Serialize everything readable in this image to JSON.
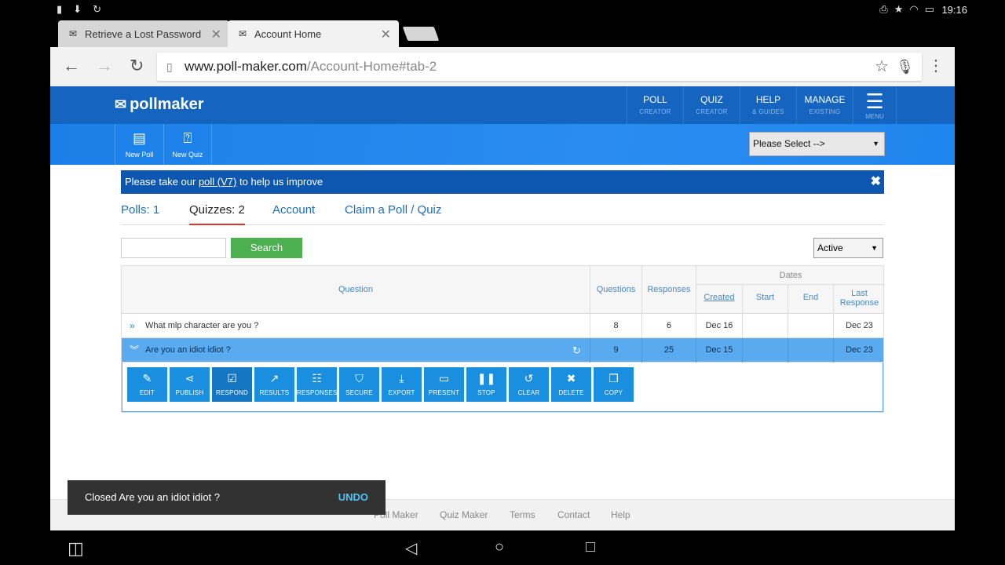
{
  "status_bar": {
    "time": "19:16"
  },
  "browser": {
    "tabs": [
      {
        "title": "Retrieve a Lost Password",
        "close": "✕"
      },
      {
        "title": "Account Home",
        "close": "✕"
      }
    ],
    "url_host": "www.poll-maker.com",
    "url_path": "/Account-Home#tab-2"
  },
  "site": {
    "logo_text": "pollmaker",
    "nav": [
      {
        "label": "POLL",
        "sub": "CREATOR"
      },
      {
        "label": "QUIZ",
        "sub": "CREATOR"
      },
      {
        "label": "HELP",
        "sub": "& GUIDES"
      },
      {
        "label": "MANAGE",
        "sub": "EXISTING"
      }
    ],
    "menu_label": "MENU",
    "subnav": [
      {
        "label": "New Poll"
      },
      {
        "label": "New Quiz"
      }
    ],
    "please_select": "Please Select -->"
  },
  "banner": {
    "prefix": "Please take our ",
    "link": "poll (V7)",
    "suffix": " to help us improve"
  },
  "subtabs": [
    {
      "label": "Polls: 1"
    },
    {
      "label": "Quizzes: 2"
    },
    {
      "label": "Account"
    },
    {
      "label": "Claim a Poll / Quiz"
    }
  ],
  "search": {
    "button": "Search",
    "value": ""
  },
  "filter": {
    "selected": "Active"
  },
  "table": {
    "headers": {
      "question": "Question",
      "questions": "Questions",
      "responses": "Responses",
      "dates": "Dates",
      "created": "Created",
      "start": "Start",
      "end": "End",
      "last_response": "Last Response"
    },
    "rows": [
      {
        "question": "What mlp character are you ?",
        "questions": "8",
        "responses": "6",
        "created": "Dec 16",
        "start": "",
        "end": "",
        "last": "Dec 23"
      },
      {
        "question": "Are you an idiot idiot ?",
        "questions": "9",
        "responses": "25",
        "created": "Dec 15",
        "start": "",
        "end": "",
        "last": "Dec 23"
      }
    ]
  },
  "actions": [
    {
      "label": "EDIT",
      "icon": "✎"
    },
    {
      "label": "PUBLISH",
      "icon": "⋖"
    },
    {
      "label": "RESPOND",
      "icon": "☑"
    },
    {
      "label": "RESULTS",
      "icon": "↗"
    },
    {
      "label": "RESPONSES",
      "icon": "☷"
    },
    {
      "label": "SECURE",
      "icon": "⛉"
    },
    {
      "label": "EXPORT",
      "icon": "⤓"
    },
    {
      "label": "PRESENT",
      "icon": "▭"
    },
    {
      "label": "STOP",
      "icon": "❚❚"
    },
    {
      "label": "CLEAR",
      "icon": "↺"
    },
    {
      "label": "DELETE",
      "icon": "✖"
    },
    {
      "label": "COPY",
      "icon": "❐"
    }
  ],
  "footer": [
    {
      "label": "Poll Maker"
    },
    {
      "label": "Quiz Maker"
    },
    {
      "label": "Terms"
    },
    {
      "label": "Contact"
    },
    {
      "label": "Help"
    }
  ],
  "snackbar": {
    "message": "Closed Are you an idiot idiot ?",
    "action": "UNDO"
  }
}
